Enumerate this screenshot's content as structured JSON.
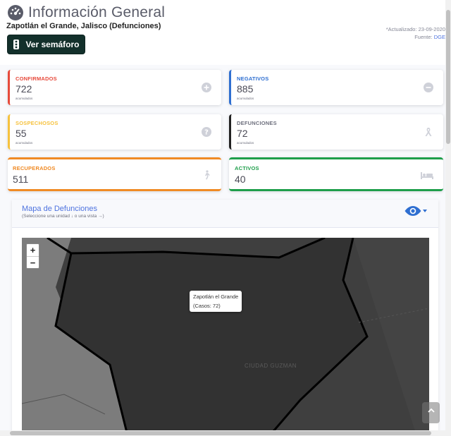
{
  "header": {
    "title": "Información General",
    "subtitle": "Zapotlán el Grande, Jalisco (Defunciones)",
    "updated": "*Actualizado: 23-09-2020",
    "source_label": "Fuente: ",
    "source": "DGE",
    "semaforo_button": "Ver semáforo"
  },
  "cards": {
    "confirmados": {
      "label": "CONFIRMADOS",
      "value": "722",
      "sub": "acumulados",
      "color": "#e74a3b",
      "icon": "plus-circle-icon"
    },
    "negativos": {
      "label": "NEGATIVOS",
      "value": "885",
      "sub": "acumulados",
      "color": "#2f6fd1",
      "icon": "minus-circle-icon"
    },
    "sospechosos": {
      "label": "SOSPECHOSOS",
      "value": "55",
      "sub": "acumulados",
      "color": "#f6c23e",
      "icon": "question-circle-icon"
    },
    "defunciones": {
      "label": "DEFUNCIONES",
      "value": "72",
      "sub": "acumulados",
      "color": "#222222",
      "icon": "ribbon-icon"
    },
    "recuperados": {
      "label": "RECUPERADOS",
      "value": "511",
      "color": "#f08a24",
      "icon": "walking-icon"
    },
    "activos": {
      "label": "ACTIVOS",
      "value": "40",
      "color": "#1e9e4a",
      "icon": "bed-icon"
    }
  },
  "map": {
    "title": "Mapa de Defunciones",
    "hint": "(Seleccione una unidad ↓ o una vista →)",
    "zoom_in": "+",
    "zoom_out": "−",
    "tooltip_name": "Zapotlán el Grande",
    "tooltip_cases": "(Casos: 72)",
    "city_label": "CIUDAD GUZMAN"
  },
  "colors": {
    "accent": "#4e73df",
    "map_fill": "#333333"
  }
}
